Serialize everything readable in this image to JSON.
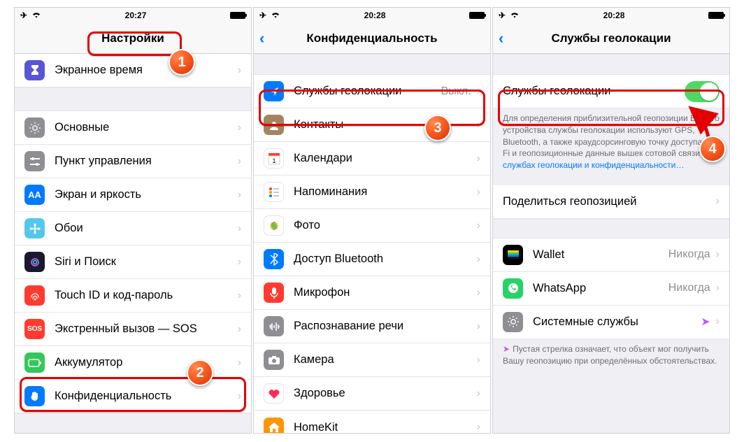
{
  "status": {
    "time1": "20:27",
    "time2": "20:28",
    "time3": "20:28"
  },
  "p1": {
    "title": "Настройки",
    "items": [
      {
        "label": "Экранное время",
        "bg": "#5856d6"
      },
      {
        "label": "Основные",
        "bg": "#8e8e93"
      },
      {
        "label": "Пункт управления",
        "bg": "#8e8e93"
      },
      {
        "label": "Экран и яркость",
        "bg": "#007aff"
      },
      {
        "label": "Обои",
        "bg": "#54c7ec"
      },
      {
        "label": "Siri и Поиск",
        "bg": "#1a1a2e"
      },
      {
        "label": "Touch ID и код-пароль",
        "bg": "#ff3b30"
      },
      {
        "label": "Экстренный вызов — SOS",
        "bg": "#ff3b30",
        "sos": "SOS"
      },
      {
        "label": "Аккумулятор",
        "bg": "#34c759"
      },
      {
        "label": "Конфиденциальность",
        "bg": "#007aff"
      }
    ]
  },
  "p2": {
    "title": "Конфиденциальность",
    "items": [
      {
        "label": "Службы геолокации",
        "detail": "Выкл.",
        "bg": "#007aff"
      },
      {
        "label": "Контакты",
        "bg": "#a2845e"
      },
      {
        "label": "Календари",
        "bg": "#ffffff"
      },
      {
        "label": "Напоминания",
        "bg": "#ffffff"
      },
      {
        "label": "Фото",
        "bg": "#ffffff"
      },
      {
        "label": "Доступ Bluetooth",
        "bg": "#007aff"
      },
      {
        "label": "Микрофон",
        "bg": "#ff3b30"
      },
      {
        "label": "Распознавание речи",
        "bg": "#8e8e93"
      },
      {
        "label": "Камера",
        "bg": "#8e8e93"
      },
      {
        "label": "Здоровье",
        "bg": "#ffffff"
      },
      {
        "label": "HomeKit",
        "bg": "#ff9500"
      }
    ]
  },
  "p3": {
    "title": "Службы геолокации",
    "toggle_label": "Службы геолокации",
    "help_text": "Для определения приблизительной геопозиции Вашего устройства службы геолокации используют GPS, Bluetooth, а также краудсорсинговую точку доступа Wi-Fi и геопозиционные данные вышек сотовой связи. ",
    "help_link": "О службах геолокации и конфиденциальности…",
    "share": "Поделиться геопозицией",
    "apps": [
      {
        "label": "Wallet",
        "detail": "Никогда",
        "bg": "#000000"
      },
      {
        "label": "WhatsApp",
        "detail": "Никогда",
        "bg": "#25d366"
      },
      {
        "label": "Системные службы",
        "detail": "",
        "bg": "#8e8e93"
      }
    ],
    "footer": "Пустая стрелка означает, что объект мог получить Вашу геопозицию при определённых обстоятельствах."
  },
  "badges": {
    "b1": "1",
    "b2": "2",
    "b3": "3",
    "b4": "4"
  }
}
